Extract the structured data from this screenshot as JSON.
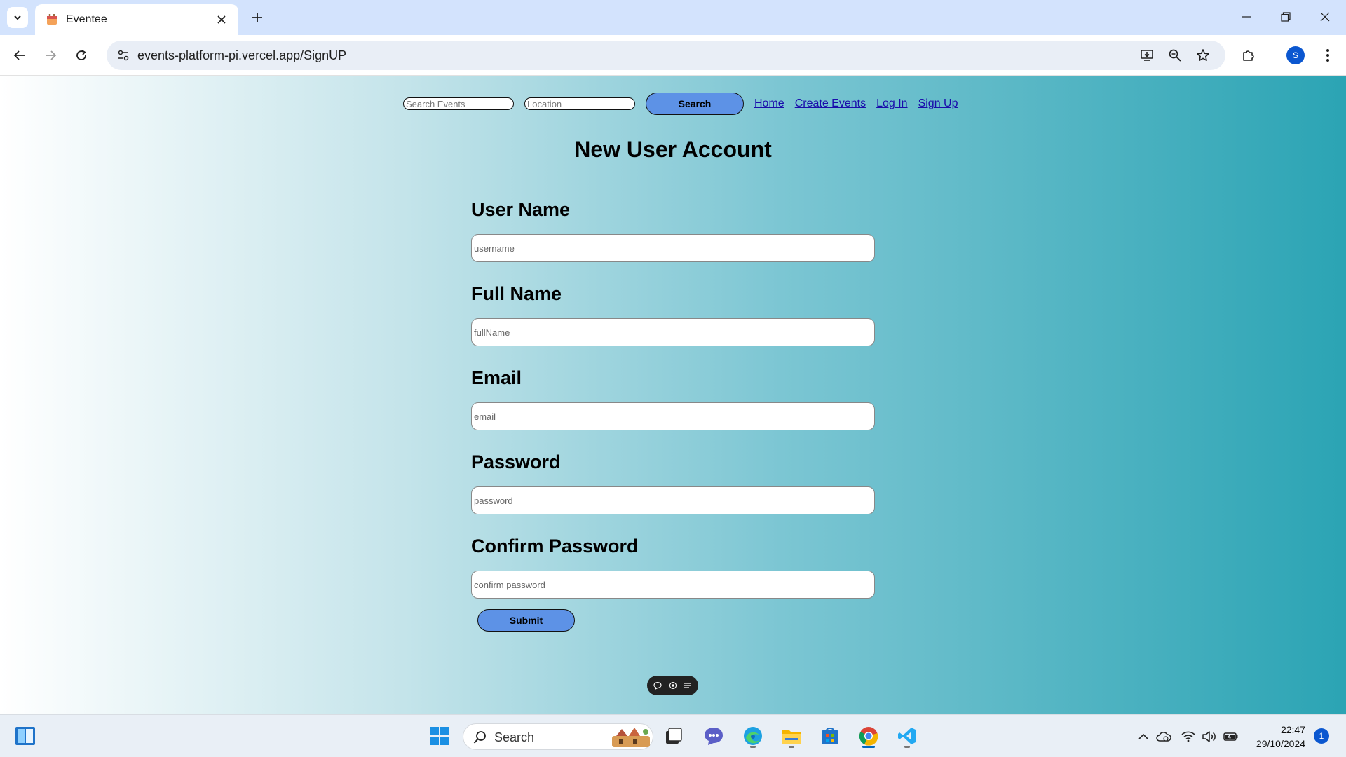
{
  "browser": {
    "tab_title": "Eventee",
    "url": "events-platform-pi.vercel.app/SignUP",
    "profile_initial": "S"
  },
  "site_header": {
    "search_placeholder": "Search Events",
    "location_placeholder": "Location",
    "search_button": "Search",
    "nav_links": [
      "Home",
      "Create Events",
      "Log In",
      "Sign Up"
    ]
  },
  "form": {
    "title": "New User Account",
    "fields": [
      {
        "label": "User Name",
        "placeholder": "username",
        "value": ""
      },
      {
        "label": "Full Name",
        "placeholder": "fullName",
        "value": ""
      },
      {
        "label": "Email",
        "placeholder": "email",
        "value": ""
      },
      {
        "label": "Password",
        "placeholder": "password",
        "value": ""
      },
      {
        "label": "Confirm Password",
        "placeholder": "confirm password",
        "value": ""
      }
    ],
    "submit_label": "Submit"
  },
  "taskbar": {
    "search_label": "Search",
    "time": "22:47",
    "date": "29/10/2024",
    "notification_count": "1"
  },
  "colors": {
    "button_fill": "#5d92e6",
    "chrome_tabbar": "#d3e3fd",
    "page_gradient_end": "#2ba4b4"
  }
}
